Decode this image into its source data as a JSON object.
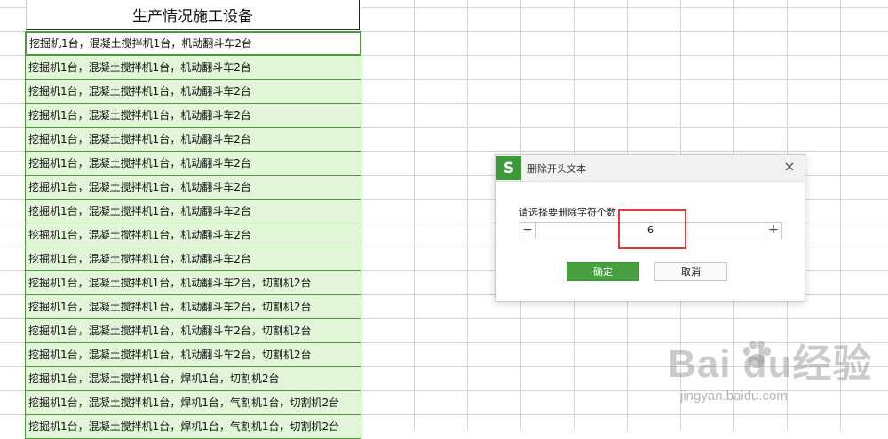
{
  "sheet": {
    "header": "生产情况施工设备",
    "rows": [
      "挖掘机1台，混凝土搅拌机1台，机动翻斗车2台",
      "挖掘机1台，混凝土搅拌机1台，机动翻斗车2台",
      "挖掘机1台，混凝土搅拌机1台，机动翻斗车2台",
      "挖掘机1台，混凝土搅拌机1台，机动翻斗车2台",
      "挖掘机1台，混凝土搅拌机1台，机动翻斗车2台",
      "挖掘机1台，混凝土搅拌机1台，机动翻斗车2台",
      "挖掘机1台，混凝土搅拌机1台，机动翻斗车2台",
      "挖掘机1台，混凝土搅拌机1台，机动翻斗车2台",
      "挖掘机1台，混凝土搅拌机1台，机动翻斗车2台",
      "挖掘机1台，混凝土搅拌机1台，机动翻斗车2台",
      "挖掘机1台，混凝土搅拌机1台，机动翻斗车2台，切割机2台",
      "挖掘机1台，混凝土搅拌机1台，机动翻斗车2台，切割机2台",
      "挖掘机1台，混凝土搅拌机1台，机动翻斗车2台，切割机2台",
      "挖掘机1台，混凝土搅拌机1台，机动翻斗车2台，切割机2台",
      "挖掘机1台，混凝土搅拌机1台，焊机1台，切割机2台",
      "挖掘机1台，混凝土搅拌机1台，焊机1台，气割机1台，切割机2台",
      "挖掘机1台，混凝土搅拌机1台，焊机1台，气割机1台，切割机2台"
    ]
  },
  "dialog": {
    "logo": "S",
    "title": "删除开头文本",
    "close": "×",
    "label": "请选择要删除字符个数",
    "stepper_minus": "−",
    "stepper_plus": "+",
    "value": "6",
    "ok_label": "确定",
    "cancel_label": "取消"
  },
  "watermark": {
    "main": "Bai  du经验",
    "sub": "jingyan.baidu.com"
  },
  "colors": {
    "accent": "#47a03e",
    "selection_border": "#4a9a3c",
    "row_fill": "#e2f5d9",
    "highlight": "#e03a3a"
  }
}
